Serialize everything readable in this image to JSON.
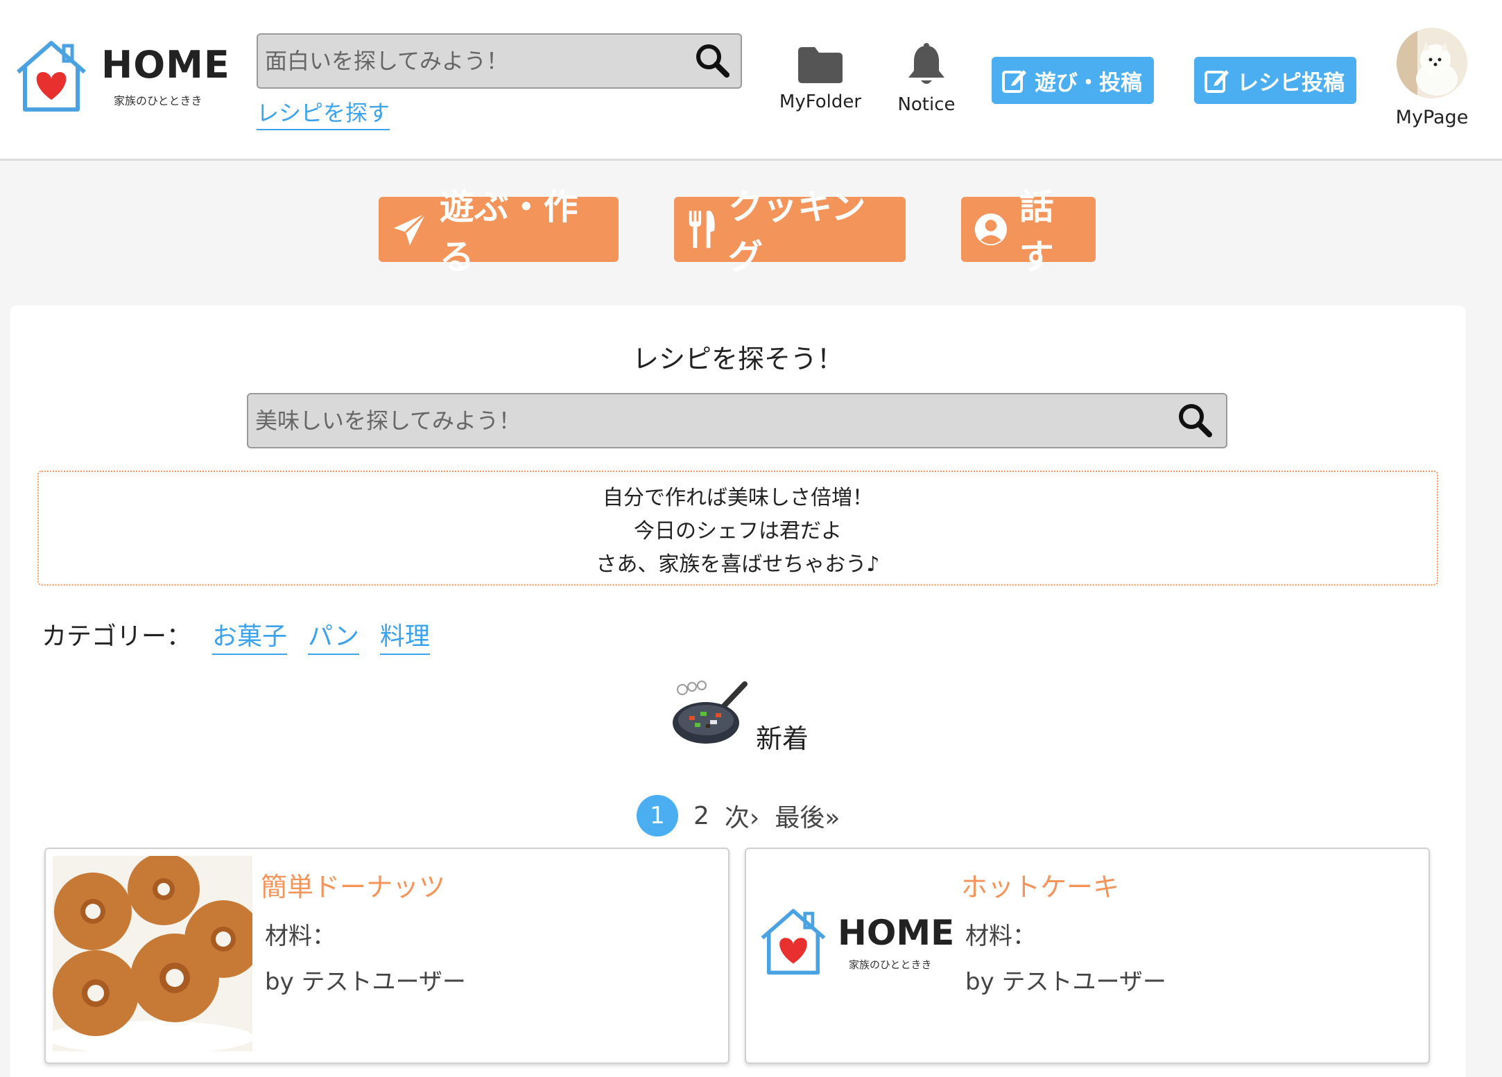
{
  "header": {
    "logo_text": "HOME",
    "logo_sub": "家族のひとときき",
    "search_placeholder": "面白いを探してみよう！",
    "recipe_link": "レシピを探す",
    "folder_label": "MyFolder",
    "notice_label": "Notice",
    "post_asobi": "遊び・投稿",
    "post_recipe": "レシピ投稿",
    "mypage_label": "MyPage"
  },
  "nav": {
    "asobi": "遊ぶ・作る",
    "cooking": "クッキング",
    "talk": "話す"
  },
  "main": {
    "title": "レシピを探そう！",
    "search_placeholder": "美味しいを探してみよう！",
    "message": [
      "自分で作れば美味しさ倍増！",
      "今日のシェフは君だよ",
      "さあ、家族を喜ばせちゃおう♪"
    ],
    "category_label": "カテゴリー：",
    "categories": [
      "お菓子",
      "パン",
      "料理"
    ],
    "new_label": "新着",
    "pager": {
      "current": "1",
      "next_page": "2",
      "next": "次›",
      "last": "最後»"
    }
  },
  "cards": [
    {
      "title": "簡単ドーナッツ",
      "ingredients": "材料：",
      "author": "by テストユーザー"
    },
    {
      "title": "ホットケーキ",
      "ingredients": "材料：",
      "author": "by テストユーザー",
      "logo_text": "HOME",
      "logo_sub": "家族のひとときき"
    }
  ],
  "colors": {
    "accent_blue": "#4aaef0",
    "accent_orange": "#f3955a",
    "heart_red": "#e8302e"
  }
}
